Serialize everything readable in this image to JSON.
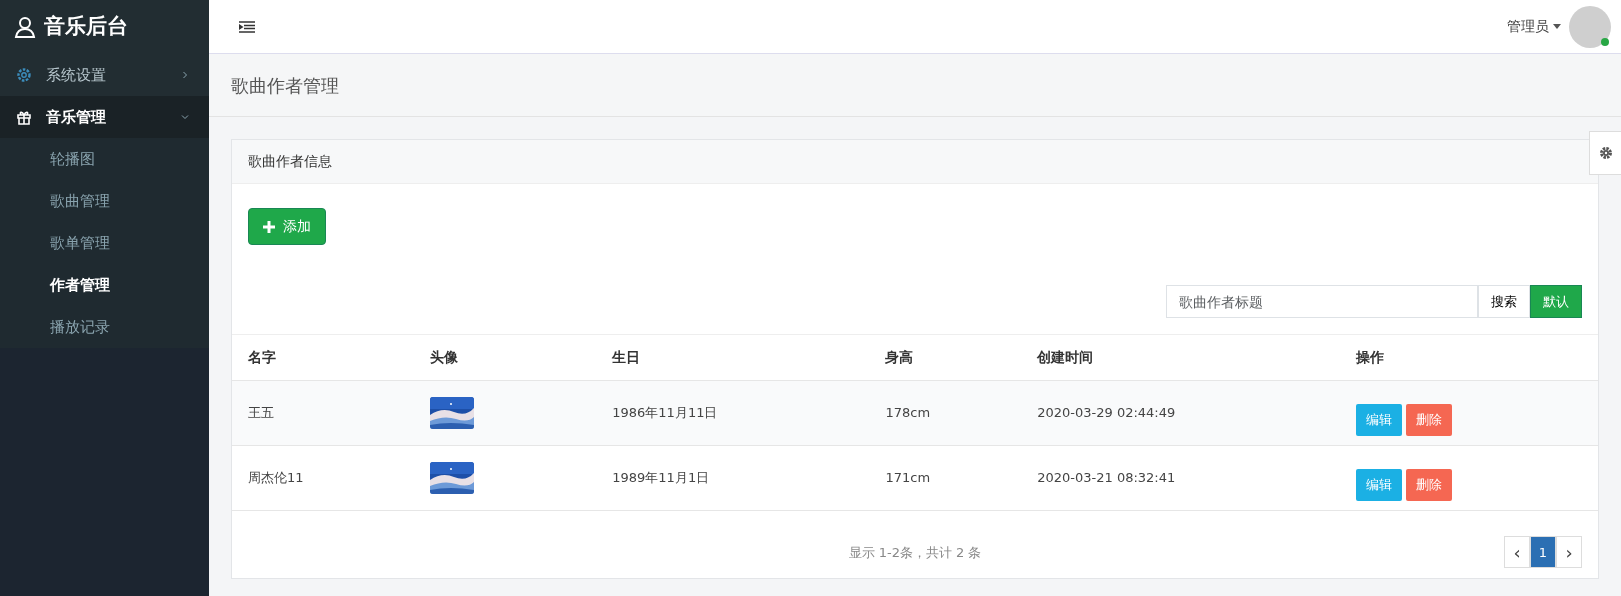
{
  "sidebar": {
    "title": "音乐后台",
    "items": [
      {
        "label": "系统设置",
        "expanded": false
      },
      {
        "label": "音乐管理",
        "expanded": true,
        "children": [
          {
            "label": "轮播图",
            "selected": false
          },
          {
            "label": "歌曲管理",
            "selected": false
          },
          {
            "label": "歌单管理",
            "selected": false
          },
          {
            "label": "作者管理",
            "selected": true
          },
          {
            "label": "播放记录",
            "selected": false
          }
        ]
      }
    ]
  },
  "topbar": {
    "user": "管理员",
    "online": true
  },
  "page_title": "歌曲作者管理",
  "card": {
    "title": "歌曲作者信息",
    "add_button": "添加",
    "search": {
      "placeholder": "歌曲作者标题",
      "search_button": "搜索",
      "default_button": "默认"
    },
    "table": {
      "columns": [
        "名字",
        "头像",
        "生日",
        "身高",
        "创建时间",
        "操作"
      ],
      "rows": [
        {
          "name": "王五",
          "birthday": "1986年11月11日",
          "height": "178cm",
          "created": "2020-03-29 02:44:49",
          "actions": [
            "编辑",
            "删除"
          ]
        },
        {
          "name": "周杰伦11",
          "birthday": "1989年11月1日",
          "height": "171cm",
          "created": "2020-03-21 08:32:41",
          "actions": [
            "编辑",
            "删除"
          ]
        }
      ]
    },
    "summary": "显示 1-2条，共计 2 条",
    "pagination": {
      "prev": "‹",
      "pages": [
        {
          "label": "1",
          "selected": true
        }
      ],
      "next": "›"
    }
  }
}
